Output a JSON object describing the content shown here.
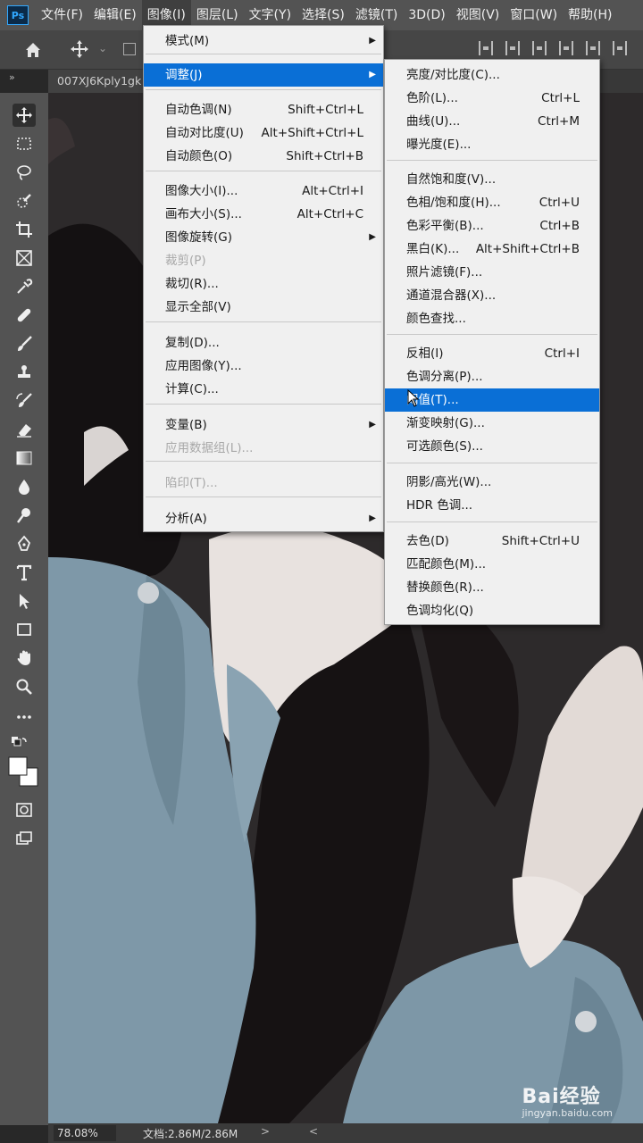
{
  "menubar": {
    "logo": "Ps",
    "items": [
      "文件(F)",
      "编辑(E)",
      "图像(I)",
      "图层(L)",
      "文字(Y)",
      "选择(S)",
      "滤镜(T)",
      "3D(D)",
      "视图(V)",
      "窗口(W)",
      "帮助(H)"
    ],
    "active_index": 2
  },
  "tabbar": {
    "collapse": "»",
    "doc_tab": "007XJ6Kply1gk"
  },
  "statusbar": {
    "zoom": "78.08%",
    "doc_info": "文档:2.86M/2.86M",
    "arrow": ">",
    "left_arrow": "<"
  },
  "watermark": {
    "brand": "Bai经验",
    "url": "jingyan.baidu.com"
  },
  "image_menu": {
    "items": [
      {
        "label": "模式(M)",
        "shortcut": "",
        "submenu": true,
        "disabled": false
      },
      {
        "label": "调整(J)",
        "shortcut": "",
        "submenu": true,
        "disabled": false,
        "highlight": true
      },
      {
        "label": "自动色调(N)",
        "shortcut": "Shift+Ctrl+L",
        "submenu": false,
        "disabled": false
      },
      {
        "label": "自动对比度(U)",
        "shortcut": "Alt+Shift+Ctrl+L",
        "submenu": false,
        "disabled": false
      },
      {
        "label": "自动颜色(O)",
        "shortcut": "Shift+Ctrl+B",
        "submenu": false,
        "disabled": false
      },
      {
        "label": "图像大小(I)...",
        "shortcut": "Alt+Ctrl+I",
        "submenu": false,
        "disabled": false
      },
      {
        "label": "画布大小(S)...",
        "shortcut": "Alt+Ctrl+C",
        "submenu": false,
        "disabled": false
      },
      {
        "label": "图像旋转(G)",
        "shortcut": "",
        "submenu": true,
        "disabled": false
      },
      {
        "label": "裁剪(P)",
        "shortcut": "",
        "submenu": false,
        "disabled": true
      },
      {
        "label": "裁切(R)...",
        "shortcut": "",
        "submenu": false,
        "disabled": false
      },
      {
        "label": "显示全部(V)",
        "shortcut": "",
        "submenu": false,
        "disabled": false
      },
      {
        "label": "复制(D)...",
        "shortcut": "",
        "submenu": false,
        "disabled": false
      },
      {
        "label": "应用图像(Y)...",
        "shortcut": "",
        "submenu": false,
        "disabled": false
      },
      {
        "label": "计算(C)...",
        "shortcut": "",
        "submenu": false,
        "disabled": false
      },
      {
        "label": "变量(B)",
        "shortcut": "",
        "submenu": true,
        "disabled": false
      },
      {
        "label": "应用数据组(L)...",
        "shortcut": "",
        "submenu": false,
        "disabled": true
      },
      {
        "label": "陷印(T)...",
        "shortcut": "",
        "submenu": false,
        "disabled": true
      },
      {
        "label": "分析(A)",
        "shortcut": "",
        "submenu": true,
        "disabled": false
      }
    ]
  },
  "adjust_menu": {
    "items": [
      {
        "label": "亮度/对比度(C)...",
        "shortcut": ""
      },
      {
        "label": "色阶(L)...",
        "shortcut": "Ctrl+L"
      },
      {
        "label": "曲线(U)...",
        "shortcut": "Ctrl+M"
      },
      {
        "label": "曝光度(E)...",
        "shortcut": ""
      },
      {
        "label": "自然饱和度(V)...",
        "shortcut": ""
      },
      {
        "label": "色相/饱和度(H)...",
        "shortcut": "Ctrl+U"
      },
      {
        "label": "色彩平衡(B)...",
        "shortcut": "Ctrl+B"
      },
      {
        "label": "黑白(K)...",
        "shortcut": "Alt+Shift+Ctrl+B"
      },
      {
        "label": "照片滤镜(F)...",
        "shortcut": ""
      },
      {
        "label": "通道混合器(X)...",
        "shortcut": ""
      },
      {
        "label": "颜色查找...",
        "shortcut": ""
      },
      {
        "label": "反相(I)",
        "shortcut": "Ctrl+I"
      },
      {
        "label": "色调分离(P)...",
        "shortcut": ""
      },
      {
        "label": "阈值(T)...",
        "shortcut": "",
        "highlight": true
      },
      {
        "label": "渐变映射(G)...",
        "shortcut": ""
      },
      {
        "label": "可选颜色(S)...",
        "shortcut": ""
      },
      {
        "label": "阴影/高光(W)...",
        "shortcut": ""
      },
      {
        "label": "HDR 色调...",
        "shortcut": ""
      },
      {
        "label": "去色(D)",
        "shortcut": "Shift+Ctrl+U"
      },
      {
        "label": "匹配颜色(M)...",
        "shortcut": ""
      },
      {
        "label": "替换颜色(R)...",
        "shortcut": ""
      },
      {
        "label": "色调均化(Q)",
        "shortcut": ""
      }
    ]
  },
  "colors": {
    "highlight": "#0a6fd6",
    "menu_bg": "#f0f0f0",
    "panel": "#535353",
    "shirt": "#7f9aab"
  }
}
